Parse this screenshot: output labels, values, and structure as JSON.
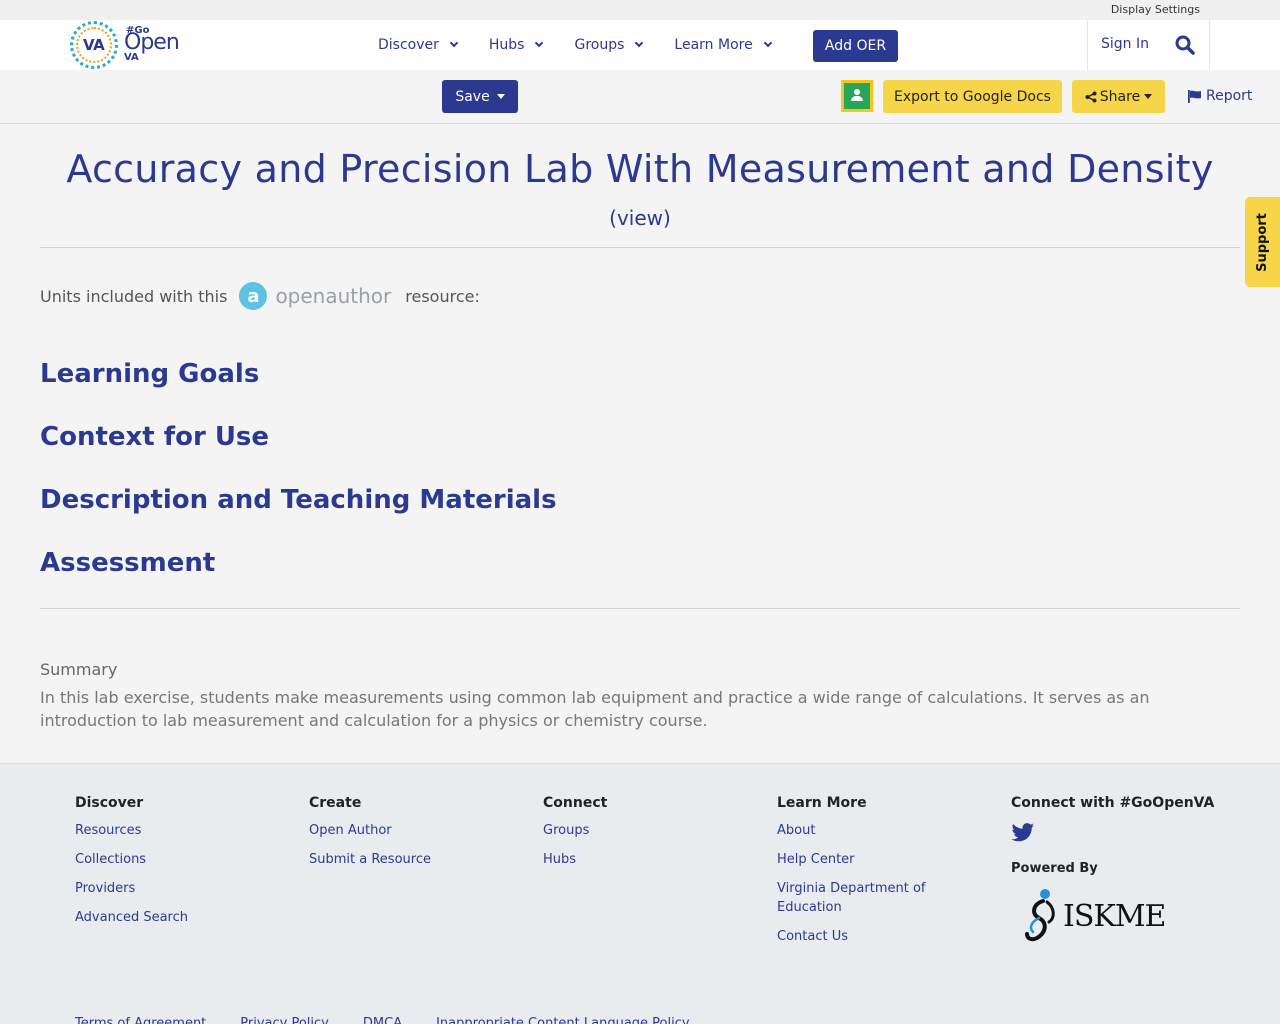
{
  "utility": {
    "display_settings": "Display Settings"
  },
  "logo": {
    "badge": "VA",
    "go": "#Go",
    "open": "Open",
    "va": "VA"
  },
  "nav": {
    "items": [
      {
        "label": "Discover"
      },
      {
        "label": "Hubs"
      },
      {
        "label": "Groups"
      },
      {
        "label": "Learn More"
      }
    ],
    "add_oer": "Add OER",
    "sign_in": "Sign In"
  },
  "toolbar": {
    "save": "Save",
    "export": "Export to Google Docs",
    "share": "Share",
    "report": "Report"
  },
  "support": "Support",
  "main": {
    "title": "Accuracy and Precision Lab With Measurement and Density",
    "view": "(view)",
    "units_prefix": "Units included with this",
    "open_author_logo": "openauthor",
    "units_suffix": "resource:",
    "sections": [
      "Learning Goals",
      "Context for Use",
      "Description and Teaching Materials",
      "Assessment"
    ],
    "summary_label": "Summary",
    "summary_text": "In this lab exercise, students make measurements using common lab equipment and practice a wide range of calculations. It serves as an introduction to lab measurement and calculation for a physics or chemistry course."
  },
  "footer": {
    "discover": {
      "heading": "Discover",
      "links": [
        "Resources",
        "Collections",
        "Providers",
        "Advanced Search"
      ]
    },
    "create": {
      "heading": "Create",
      "links": [
        "Open Author",
        "Submit a Resource"
      ]
    },
    "connect": {
      "heading": "Connect",
      "links": [
        "Groups",
        "Hubs"
      ]
    },
    "learn_more": {
      "heading": "Learn More",
      "links": [
        "About",
        "Help Center",
        "Virginia Department of Education",
        "Contact Us"
      ]
    },
    "social": {
      "heading": "Connect with #GoOpenVA",
      "powered_by": "Powered By",
      "iskme": "ISKME"
    },
    "legal": [
      "Terms of Agreement",
      "Privacy Policy",
      "DMCA",
      "Inappropriate Content Language Policy"
    ]
  },
  "colors": {
    "primary": "#2b3990",
    "accent_yellow": "#f7d548",
    "classroom_green": "#26a65b"
  }
}
